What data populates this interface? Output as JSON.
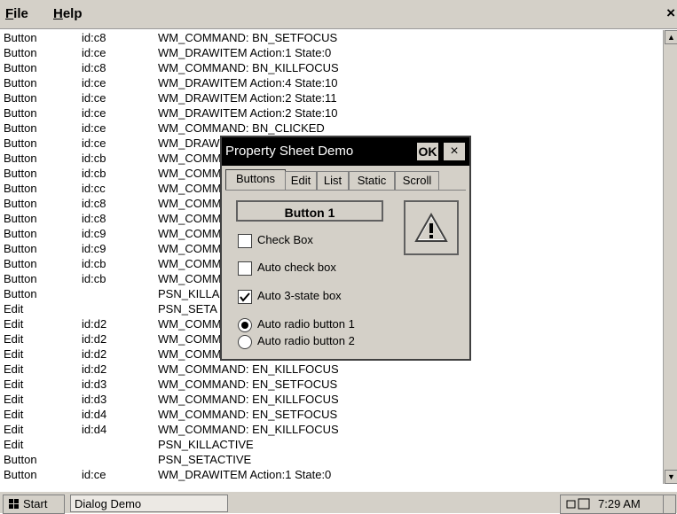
{
  "menubar": {
    "file": "File",
    "file_mn": "F",
    "file_rest": "ile",
    "help": "Help",
    "help_mn": "H",
    "help_rest": "elp",
    "close": "×"
  },
  "log": [
    [
      "Button",
      "id:c8",
      "WM_COMMAND: BN_SETFOCUS"
    ],
    [
      "Button",
      "id:ce",
      "WM_DRAWITEM  Action:1  State:0"
    ],
    [
      "Button",
      "id:c8",
      "WM_COMMAND: BN_KILLFOCUS"
    ],
    [
      "Button",
      "id:ce",
      "WM_DRAWITEM  Action:4  State:10"
    ],
    [
      "Button",
      "id:ce",
      "WM_DRAWITEM  Action:2  State:11"
    ],
    [
      "Button",
      "id:ce",
      "WM_DRAWITEM  Action:2  State:10"
    ],
    [
      "Button",
      "id:ce",
      "WM_COMMAND: BN_CLICKED"
    ],
    [
      "Button",
      "id:ce",
      "WM_DRAW"
    ],
    [
      "Button",
      "id:cb",
      "WM_COMM"
    ],
    [
      "Button",
      "id:cb",
      "WM_COMM"
    ],
    [
      "Button",
      "id:cc",
      "WM_COMM"
    ],
    [
      "Button",
      "id:c8",
      "WM_COMM"
    ],
    [
      "Button",
      "id:c8",
      "WM_COMM"
    ],
    [
      "Button",
      "id:c9",
      "WM_COMM"
    ],
    [
      "Button",
      "id:c9",
      "WM_COMM"
    ],
    [
      "Button",
      "id:cb",
      "WM_COMM"
    ],
    [
      "Button",
      "id:cb",
      "WM_COMM"
    ],
    [
      "Button",
      "",
      "PSN_KILLA"
    ],
    [
      "Edit",
      "",
      "PSN_SETA"
    ],
    [
      "Edit",
      "id:d2",
      "WM_COMM"
    ],
    [
      "Edit",
      "id:d2",
      "WM_COMM"
    ],
    [
      "Edit",
      "id:d2",
      "WM_COMM"
    ],
    [
      "Edit",
      "id:d2",
      "WM_COMMAND: EN_KILLFOCUS"
    ],
    [
      "Edit",
      "id:d3",
      "WM_COMMAND: EN_SETFOCUS"
    ],
    [
      "Edit",
      "id:d3",
      "WM_COMMAND: EN_KILLFOCUS"
    ],
    [
      "Edit",
      "id:d4",
      "WM_COMMAND: EN_SETFOCUS"
    ],
    [
      "Edit",
      "id:d4",
      "WM_COMMAND: EN_KILLFOCUS"
    ],
    [
      "Edit",
      "",
      "PSN_KILLACTIVE"
    ],
    [
      "Button",
      "",
      "PSN_SETACTIVE"
    ],
    [
      "Button",
      "id:ce",
      "WM_DRAWITEM  Action:1  State:0"
    ]
  ],
  "dialog": {
    "title": "Property Sheet Demo",
    "ok_label": "OK",
    "close_label": "×",
    "tabs": [
      "Buttons",
      "Edit",
      "List",
      "Static",
      "Scroll"
    ],
    "button1_label": "Button 1",
    "check_box_label": "Check Box",
    "auto_check_label": "Auto check box",
    "auto_3state_label": "Auto 3-state box",
    "radio1_label": "Auto radio button 1",
    "radio2_label": "Auto radio button 2"
  },
  "taskbar": {
    "start_label": "Start",
    "task_label": "Dialog Demo",
    "clock": "7:29 AM"
  }
}
